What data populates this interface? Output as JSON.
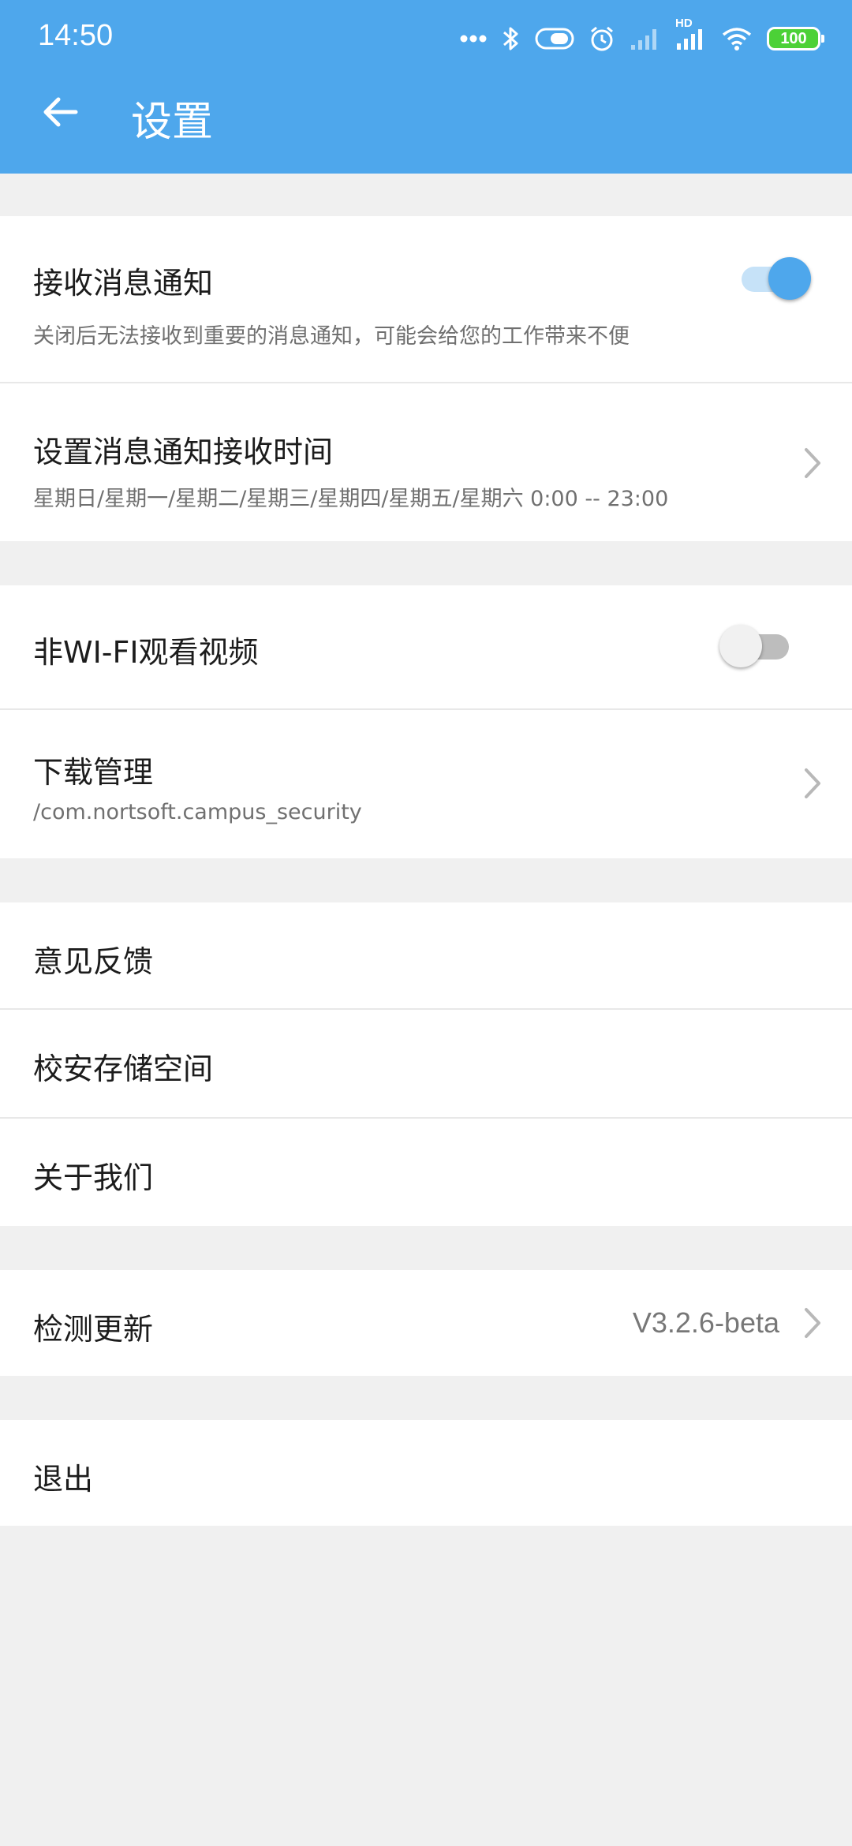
{
  "status_bar": {
    "time": "14:50",
    "hd_label": "HD",
    "battery": "100",
    "icons": [
      "more-dots-icon",
      "bluetooth-icon",
      "toggle-pill-icon",
      "alarm-icon",
      "signal-icon",
      "signal-hd-icon",
      "wifi-icon",
      "battery-icon"
    ]
  },
  "header": {
    "title": "设置",
    "back_icon": "arrow-left-icon"
  },
  "colors": {
    "accent": "#4ea7ec",
    "background": "#f0f0f0",
    "battery": "#4cd137"
  },
  "settings": {
    "notify": {
      "title": "接收消息通知",
      "subtitle": "关闭后无法接收到重要的消息通知，可能会给您的工作带来不便",
      "enabled": true
    },
    "notify_time": {
      "title": "设置消息通知接收时间",
      "subtitle": "星期日/星期一/星期二/星期三/星期四/星期五/星期六 0:00 -- 23:00"
    },
    "wifi_video": {
      "title": "非WI-FI观看视频",
      "enabled": false
    },
    "download": {
      "title": "下载管理",
      "subtitle": "/com.nortsoft.campus_security"
    },
    "feedback": {
      "title": "意见反馈"
    },
    "storage": {
      "title": "校安存储空间"
    },
    "about": {
      "title": "关于我们"
    },
    "update": {
      "title": "检测更新",
      "version": "V3.2.6-beta"
    },
    "logout": {
      "title": "退出"
    }
  }
}
